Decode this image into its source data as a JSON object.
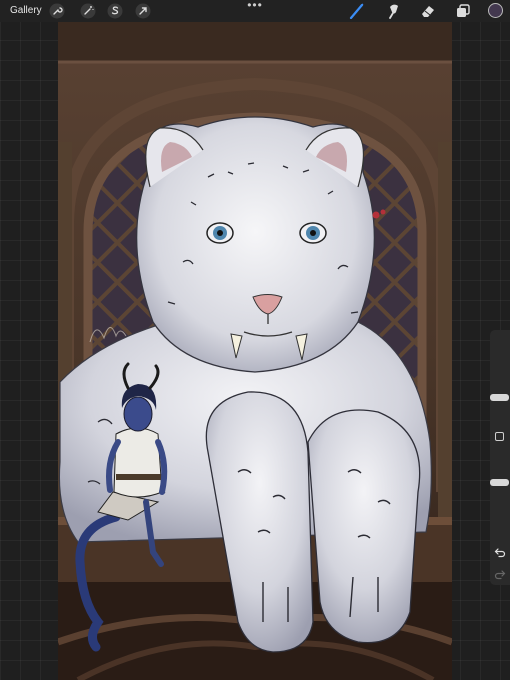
{
  "app": {
    "gallery_label": "Gallery"
  },
  "toolbar": {
    "actions": [
      "wrench-icon",
      "magic-wand-icon",
      "selection-icon",
      "transform-arrow-icon"
    ],
    "tools": [
      "brush-icon",
      "smudge-icon",
      "eraser-icon",
      "layers-icon"
    ],
    "active_tool": "brush-icon",
    "current_color": "#43384f",
    "accent": "#3b8df5"
  },
  "sidebar": {
    "brush_size_level": 0.55,
    "opacity_level": 0.45,
    "controls": [
      "brush-size-slider",
      "modify-button",
      "opacity-slider",
      "undo-icon",
      "redo-icon"
    ]
  },
  "canvas": {
    "subject": "illustration"
  }
}
